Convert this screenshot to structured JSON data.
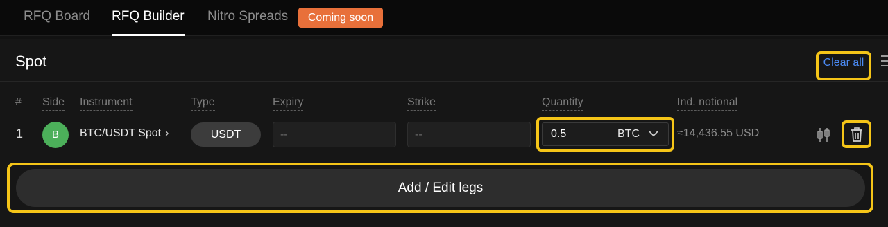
{
  "tabs": [
    {
      "label": "RFQ Board",
      "active": false
    },
    {
      "label": "RFQ Builder",
      "active": true
    },
    {
      "label": "Nitro Spreads",
      "active": false
    }
  ],
  "badge": {
    "label": "Coming soon",
    "color": "#e8703a"
  },
  "section": {
    "title": "Spot",
    "clear_label": "Clear all"
  },
  "columns": [
    "#",
    "Side",
    "Instrument",
    "Type",
    "Expiry",
    "Strike",
    "Quantity",
    "Ind. notional"
  ],
  "leg": {
    "index": "1",
    "side": "B",
    "instrument": "BTC/USDT Spot",
    "type": "USDT",
    "expiry": "--",
    "strike": "--",
    "quantity": "0.5",
    "quantity_unit": "BTC",
    "notional": "≈14,436.55 USD"
  },
  "add_legs_label": "Add / Edit legs",
  "colors": {
    "accent_highlight": "#f5c518",
    "link": "#4b8bf5",
    "buy_side": "#4caf5a"
  },
  "icons": [
    "chevron-right-icon",
    "chevron-down-icon",
    "rfq-toggle-icon",
    "trash-icon",
    "menu-icon"
  ]
}
